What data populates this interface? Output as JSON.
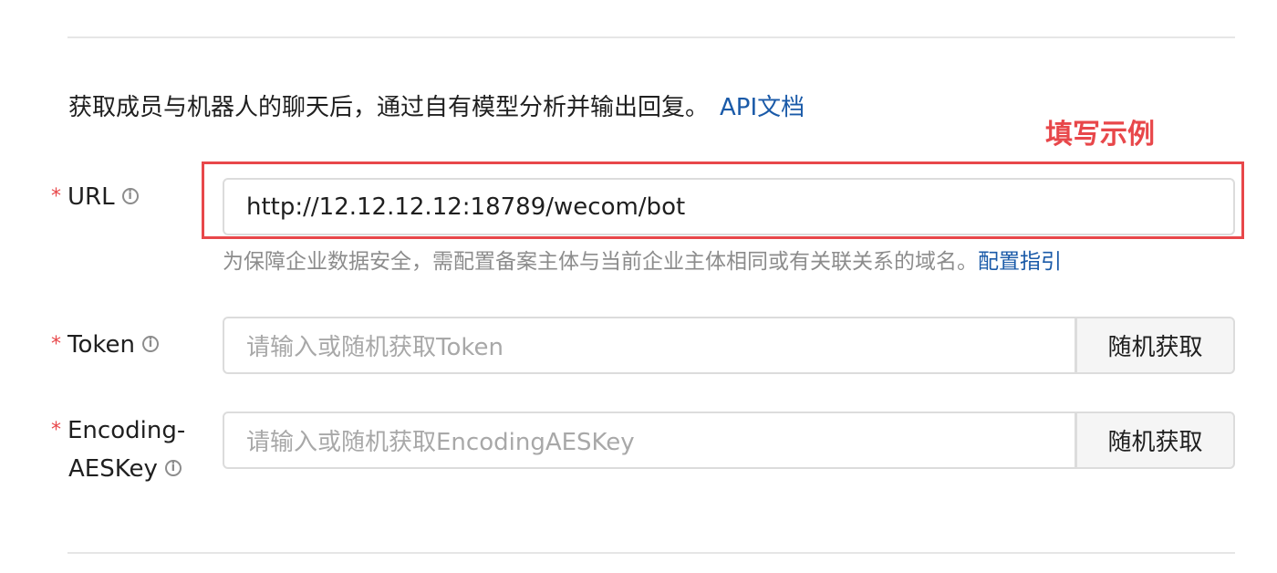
{
  "description": {
    "text": "获取成员与机器人的聊天后，通过自有模型分析并输出回复。",
    "api_doc_link": "API文档"
  },
  "annotation": {
    "label": "填写示例",
    "color": "#e8474a"
  },
  "form": {
    "required_mark": "*",
    "url": {
      "label": "URL",
      "value": "http://12.12.12.12:18789/wecom/bot",
      "hint": "为保障企业数据安全，需配置备案主体与当前企业主体相同或有关联关系的域名。",
      "hint_link": "配置指引"
    },
    "token": {
      "label": "Token",
      "placeholder": "请输入或随机获取Token",
      "button_label": "随机获取"
    },
    "aeskey": {
      "label_line1": "Encoding-",
      "label_line2": "AESKey",
      "placeholder": "请输入或随机获取EncodingAESKey",
      "button_label": "随机获取"
    }
  },
  "colors": {
    "link": "#1a5aa8",
    "required": "#e8474a",
    "border": "#dcdcdc"
  }
}
